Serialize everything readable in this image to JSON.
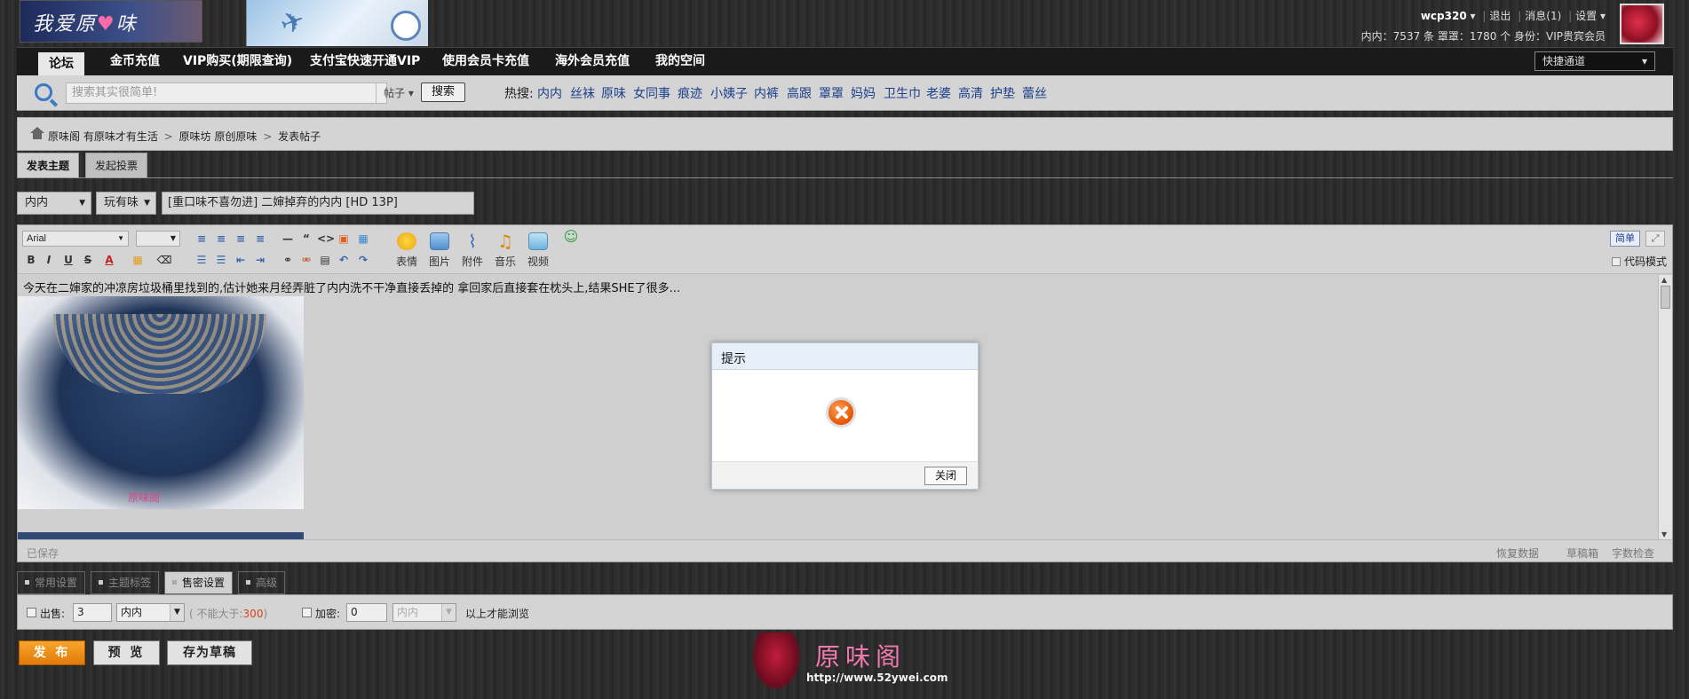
{
  "header": {
    "logo_text": "我爱原",
    "logo_heart": "♥",
    "logo_text2": "味",
    "username": "wcp320",
    "logout": "退出",
    "messages": "消息(1)",
    "settings": "设置",
    "stats": "内内：7537 条   罩罩：1780 个   身份：VIP贵宾会员",
    "icons": {
      "plane": "airplane-icon",
      "clock": "clock-icon"
    }
  },
  "nav": {
    "items": [
      "论坛",
      "金币充值",
      "VIP购买(期限查询)",
      "支付宝快速开通VIP",
      "使用会员卡充值",
      "海外会员充值",
      "我的空间"
    ],
    "quick": "快捷通道"
  },
  "search": {
    "placeholder": "搜索其实很简单!",
    "type": "帖子",
    "button": "搜索",
    "hot_label": "热搜:",
    "hot_terms": [
      "内内",
      "丝袜",
      "原味",
      "女同事",
      "痕迹",
      "小姨子",
      "内裤",
      "高跟",
      "罩罩",
      "妈妈",
      "卫生巾",
      "老婆",
      "高清",
      "护垫",
      "蕾丝"
    ]
  },
  "breadcrumb": {
    "items": [
      "原味阁 有原味才有生活",
      "原味坊 原创原味",
      "发表帖子"
    ],
    "sep": ">"
  },
  "post_tabs": {
    "topic": "发表主题",
    "poll": "发起投票"
  },
  "subject": {
    "category": "内内",
    "subtype": "玩有味",
    "title": "[重口味不喜勿进] 二婶掉弃的内内 [HD 13P]"
  },
  "editor": {
    "font": "Arial",
    "tools_row1": [
      "≡",
      "≡",
      "≡",
      "≡",
      "—",
      "“",
      "<>"
    ],
    "tools_row2": [
      "B",
      "I",
      "U",
      "S",
      "A"
    ],
    "big_tools": [
      "表情",
      "图片",
      "附件",
      "音乐",
      "视频"
    ],
    "simple": "简单",
    "code_mode": "代码模式",
    "content": "今天在二婶家的冲凉房垃圾桶里找到的,估计她来月经弄脏了内内洗不干净直接丢掉的 拿回家后直接套在枕头上,结果SHE了很多...",
    "photo_mark": "原味阁",
    "saved": "已保存",
    "status_links": [
      "恢复数据",
      "草稿箱",
      "字数检查"
    ]
  },
  "settings_tabs": [
    "常用设置",
    "主题标签",
    "售密设置",
    "高级"
  ],
  "sale": {
    "sell_label": "出售:",
    "sell_value": "3",
    "sell_unit": "内内",
    "limit_prefix": "( 不能大于:",
    "limit_value": "300",
    "limit_suffix": ")",
    "encrypt_label": "加密:",
    "encrypt_value": "0",
    "encrypt_unit": "内内",
    "encrypt_suffix": "以上才能浏览"
  },
  "actions": {
    "publish": "发 布",
    "preview": "预 览",
    "draft": "存为草稿"
  },
  "footer": {
    "name": "原味阁",
    "url": "http://www.52ywei.com"
  },
  "dialog": {
    "title": "提示",
    "close": "关闭",
    "icon": "error-icon"
  },
  "colors": {
    "accent_orange": "#e27a0a",
    "link_blue": "#1c3f8a",
    "error_orange": "#e65400",
    "brand_pink": "#f07ab0"
  }
}
